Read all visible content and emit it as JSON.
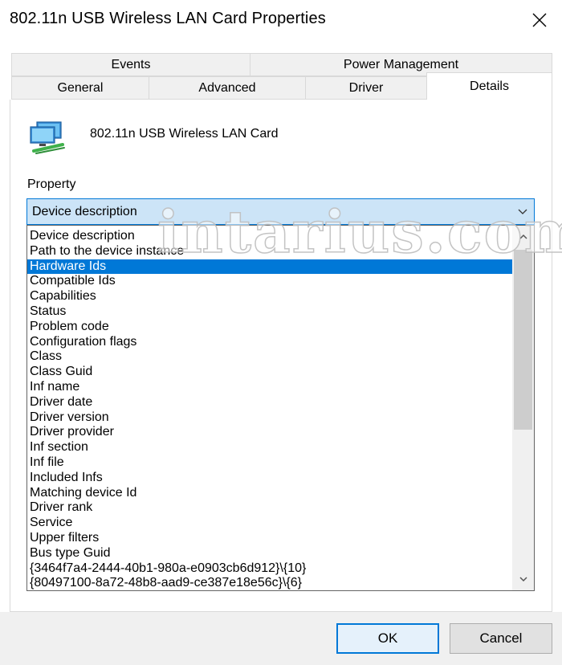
{
  "window": {
    "title": "802.11n USB Wireless LAN Card Properties",
    "close_icon": "close-icon"
  },
  "tabs": {
    "row1": [
      {
        "label": "Events"
      },
      {
        "label": "Power Management"
      }
    ],
    "row2": [
      {
        "label": "General"
      },
      {
        "label": "Advanced"
      },
      {
        "label": "Driver"
      },
      {
        "label": "Details",
        "active": true
      }
    ]
  },
  "device": {
    "icon": "network-adapter-icon",
    "name": "802.11n USB Wireless LAN Card"
  },
  "property": {
    "label": "Property",
    "selected_value": "Device description",
    "options": [
      "Device description",
      "Path to the device instance",
      "Hardware Ids",
      "Compatible Ids",
      "Capabilities",
      "Status",
      "Problem code",
      "Configuration flags",
      "Class",
      "Class Guid",
      "Inf name",
      "Driver date",
      "Driver version",
      "Driver provider",
      "Inf section",
      "Inf file",
      "Included Infs",
      "Matching device Id",
      "Driver rank",
      "Service",
      "Upper filters",
      "Bus type Guid",
      "{3464f7a4-2444-40b1-980a-e0903cb6d912}\\{10}",
      "{80497100-8a72-48b8-aad9-ce387e18e56c}\\{6}"
    ],
    "highlighted_option": "Hardware Ids"
  },
  "watermark": "intarius.com",
  "buttons": {
    "ok": "OK",
    "cancel": "Cancel"
  },
  "colors": {
    "accent": "#0078d7",
    "combo_bg": "#cce4f7",
    "selection": "#0078d7",
    "dialog_bg": "#f0f0f0"
  }
}
